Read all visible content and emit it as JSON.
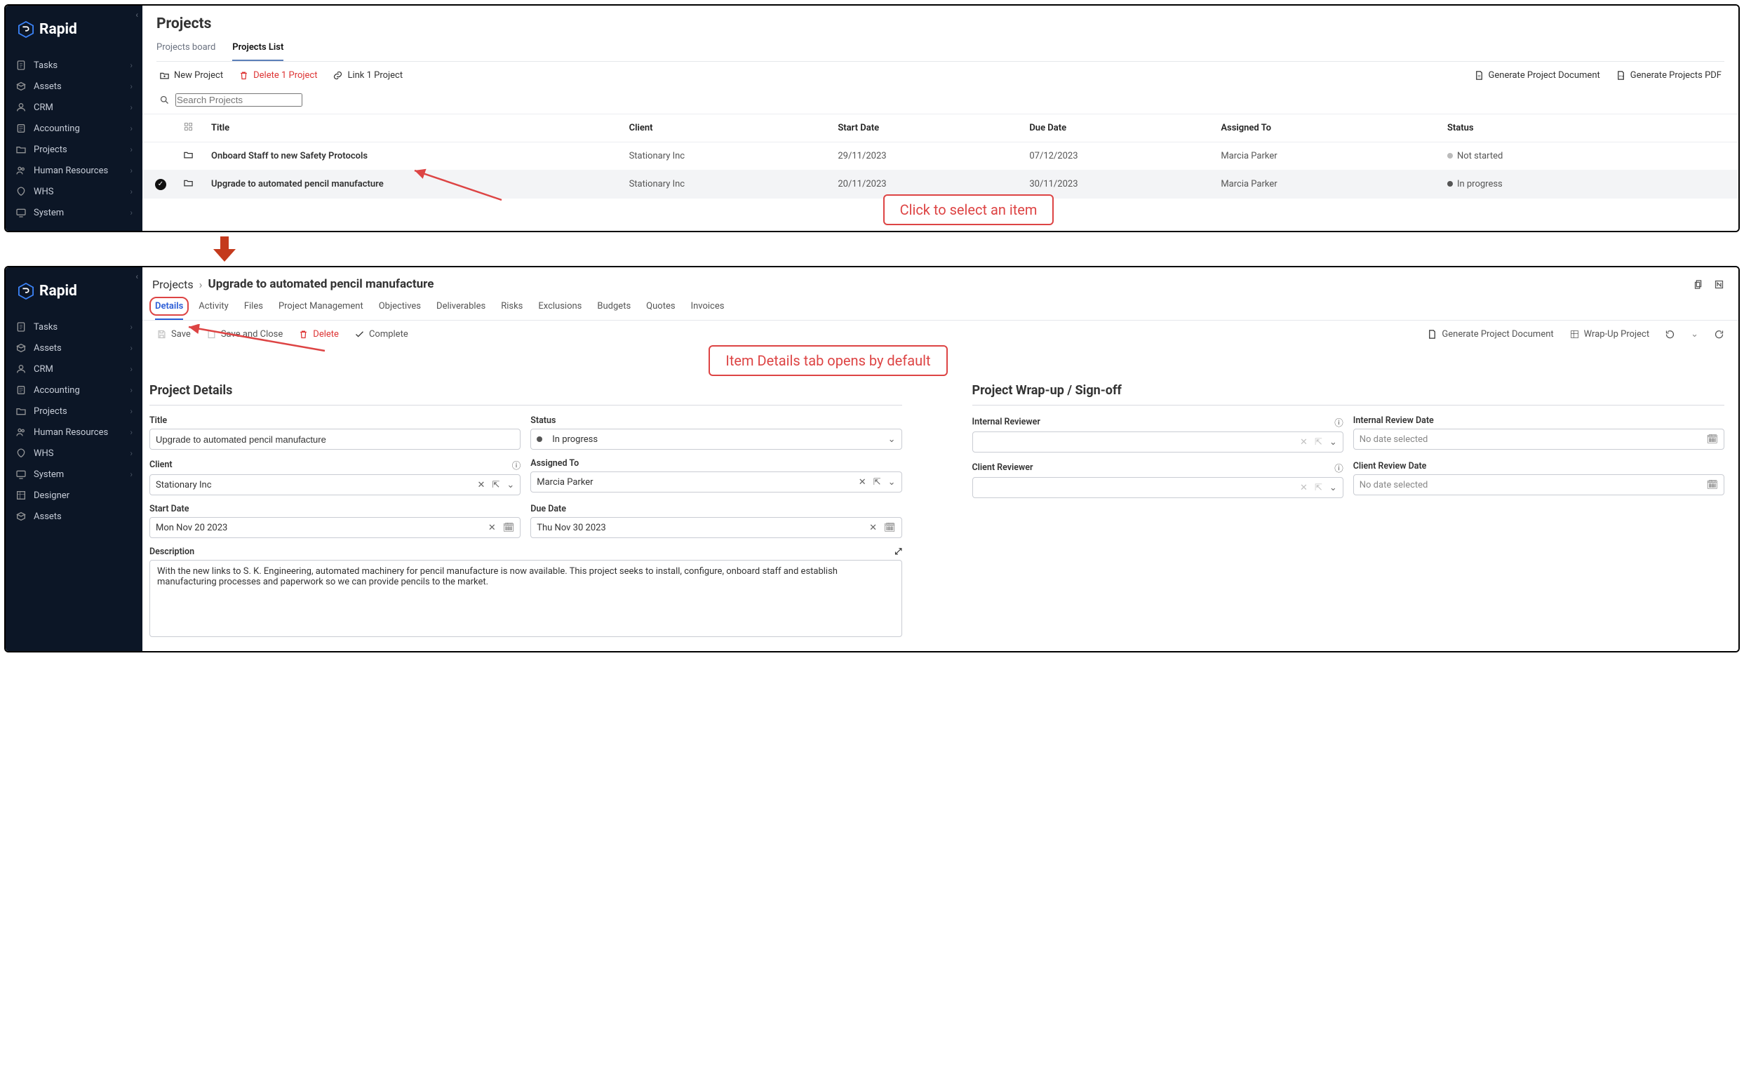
{
  "brand": "Rapid",
  "top": {
    "pageTitle": "Projects",
    "sidebar": {
      "items": [
        {
          "label": "Tasks"
        },
        {
          "label": "Assets"
        },
        {
          "label": "CRM"
        },
        {
          "label": "Accounting"
        },
        {
          "label": "Projects"
        },
        {
          "label": "Human Resources"
        },
        {
          "label": "WHS"
        },
        {
          "label": "System"
        }
      ]
    },
    "tabs": [
      {
        "label": "Projects board"
      },
      {
        "label": "Projects List"
      }
    ],
    "toolbar": {
      "newProject": "New Project",
      "deleteProject": "Delete 1 Project",
      "linkProject": "Link 1 Project",
      "genDoc": "Generate Project Document",
      "genPdf": "Generate Projects PDF"
    },
    "searchPlaceholder": "Search Projects",
    "columns": {
      "title": "Title",
      "client": "Client",
      "start": "Start Date",
      "due": "Due Date",
      "assigned": "Assigned To",
      "status": "Status"
    },
    "rows": [
      {
        "selected": false,
        "title": "Onboard Staff to new Safety Protocols",
        "client": "Stationary Inc",
        "start": "29/11/2023",
        "due": "07/12/2023",
        "assigned": "Marcia Parker",
        "status": "Not started",
        "statusKind": "notstarted"
      },
      {
        "selected": true,
        "title": "Upgrade to automated pencil manufacture",
        "client": "Stationary Inc",
        "start": "20/11/2023",
        "due": "30/11/2023",
        "assigned": "Marcia Parker",
        "status": "In progress",
        "statusKind": "progress"
      }
    ],
    "annotation": "Click to select an item"
  },
  "bottom": {
    "breadcrumbRoot": "Projects",
    "breadcrumbCurrent": "Upgrade to automated pencil manufacture",
    "sidebar": {
      "items": [
        {
          "label": "Tasks"
        },
        {
          "label": "Assets"
        },
        {
          "label": "CRM"
        },
        {
          "label": "Accounting"
        },
        {
          "label": "Projects"
        },
        {
          "label": "Human Resources"
        },
        {
          "label": "WHS"
        },
        {
          "label": "System"
        },
        {
          "label": "Designer"
        },
        {
          "label": "Assets"
        }
      ]
    },
    "subtabs": [
      "Details",
      "Activity",
      "Files",
      "Project Management",
      "Objectives",
      "Deliverables",
      "Risks",
      "Exclusions",
      "Budgets",
      "Quotes",
      "Invoices"
    ],
    "toolbar": {
      "save": "Save",
      "saveClose": "Save and Close",
      "delete": "Delete",
      "complete": "Complete",
      "genDoc": "Generate Project Document",
      "wrapUp": "Wrap-Up Project"
    },
    "annotation": "Item Details tab opens by default",
    "sections": {
      "left": {
        "heading": "Project Details"
      },
      "right": {
        "heading": "Project Wrap-up / Sign-off"
      }
    },
    "fields": {
      "titleLabel": "Title",
      "titleValue": "Upgrade to automated pencil manufacture",
      "statusLabel": "Status",
      "statusValue": "In progress",
      "clientLabel": "Client",
      "clientValue": "Stationary Inc",
      "assignedLabel": "Assigned To",
      "assignedValue": "Marcia Parker",
      "startLabel": "Start Date",
      "startValue": "Mon Nov 20 2023",
      "dueLabel": "Due Date",
      "dueValue": "Thu Nov 30 2023",
      "descLabel": "Description",
      "descValue": "With the new links to S. K. Engineering, automated machinery for pencil manufacture is now available. This project seeks to install, configure, onboard staff and establish manufacturing processes and paperwork so we can provide pencils to the market.",
      "internalReviewerLabel": "Internal Reviewer",
      "internalReviewDateLabel": "Internal Review Date",
      "clientReviewerLabel": "Client Reviewer",
      "clientReviewDateLabel": "Client Review Date",
      "noDate": "No date selected"
    }
  }
}
